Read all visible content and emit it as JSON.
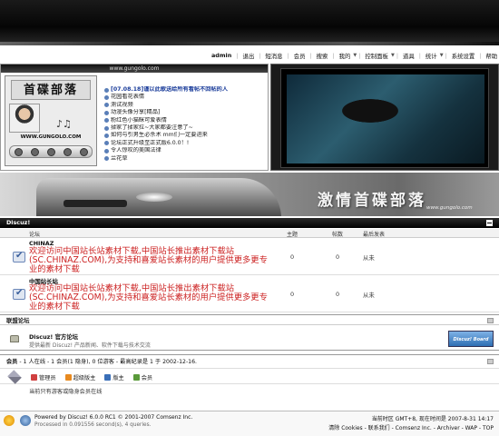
{
  "nav": {
    "user": "admin",
    "items": [
      "退出",
      "短消息",
      "会员",
      "搜索",
      "我的",
      "控制面板",
      "道具",
      "统计",
      "系统设置",
      "帮助"
    ]
  },
  "left_panel": {
    "url": "www.gungolo.com",
    "logo_title": "首碟部落",
    "logo_url": "WWW.GUNGOLO.COM",
    "news": [
      "[07.08.18]谨以此歌送给所有看帖不回帖的人",
      "花园看花表情",
      "测试视频",
      "动漫头像分享[精品]",
      "粉红色小猫眯可爱表情",
      "揉家了揉家拉~大家都要注意了~",
      "如何与引男生必杀术 mm们一定要进来",
      "论坛正式升级至正式版6.0.0！!",
      "令人惊叹的美国法律",
      "兰花草"
    ]
  },
  "banner": {
    "title": "激情首碟部落",
    "url": "www.gungolo.com"
  },
  "category": {
    "name": "Discuz!",
    "columns": {
      "forum": "论坛",
      "threads": "主题",
      "posts": "帖数",
      "last_post": "最后发表"
    }
  },
  "forums": [
    {
      "name": "CHINAZ",
      "desc": "欢迎访问中国站长站素材下载,中国站长推出素材下载站(SC.CHINAZ.COM),为支持和喜爱站长素材的用户提供更多更专业的素材下载",
      "threads": "0",
      "posts": "0",
      "last": "从未"
    },
    {
      "name": "中国站长站",
      "desc": "欢迎访问中国站长站素材下载,中国站长推出素材下载站(SC.CHINAZ.COM),为支持和喜爱站长素材的用户提供更多更专业的素材下载",
      "threads": "0",
      "posts": "0",
      "last": "从未"
    }
  ],
  "affiliate": {
    "header": "联盟论坛",
    "name": "Discuz! 官方论坛",
    "desc": "提供最新 Discuz! 产品新闻、软件下载与技术交流",
    "logo_text": "Discuz! Board"
  },
  "members": {
    "label": "会员",
    "summary": "- 1 人在线 - 1 会员(1 隐身), 0 位游客 - 最高纪录是 1 于 2002-12-16.",
    "legend": [
      {
        "label": "管理员",
        "color": "#d04040"
      },
      {
        "label": "超级版主",
        "color": "#e88a20"
      },
      {
        "label": "版主",
        "color": "#3a6fb8"
      },
      {
        "label": "会员",
        "color": "#5a9a3a"
      }
    ],
    "note": "当前只有游客或隐身会员在线"
  },
  "footer": {
    "powered": "Powered by Discuz! 6.0.0 RC1 © 2001-2007 Comsenz Inc.",
    "processed": "Processed in 0.091556 second(s), 4 queries.",
    "timezone": "当前时区 GMT+8, 现在时间是 2007-8-31 14:17",
    "links": "清除 Cookies - 联系我们 - Comsenz Inc. - Archiver - WAP - TOP"
  }
}
